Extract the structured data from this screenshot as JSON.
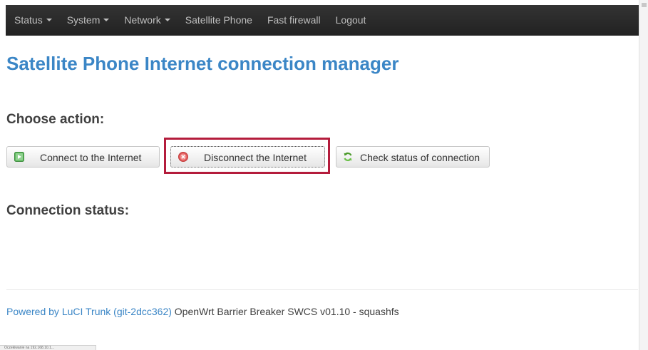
{
  "nav": {
    "items": [
      {
        "label": "Status",
        "dropdown": true
      },
      {
        "label": "System",
        "dropdown": true
      },
      {
        "label": "Network",
        "dropdown": true
      },
      {
        "label": "Satellite Phone",
        "dropdown": false
      },
      {
        "label": "Fast firewall",
        "dropdown": false
      },
      {
        "label": "Logout",
        "dropdown": false
      }
    ]
  },
  "page": {
    "title": "Satellite Phone Internet connection manager",
    "choose_action_heading": "Choose action:",
    "connection_status_heading": "Connection status:"
  },
  "actions": {
    "connect": {
      "label": "Connect to the Internet",
      "icon": "play-icon"
    },
    "disconnect": {
      "label": "Disconnect the Internet",
      "icon": "stop-circle-icon"
    },
    "check": {
      "label": "Check status of connection",
      "icon": "refresh-icon"
    }
  },
  "footer": {
    "link_text": "Powered by LuCI Trunk (git-2dcc362)",
    "text": " OpenWrt Barrier Breaker SWCS v01.10 - squashfs"
  },
  "statusbar": {
    "text": "Oczekiwanie na 192.168.10.1..."
  },
  "colors": {
    "navbar_bg": "#2b2b2b",
    "title": "#3b86c6",
    "link": "#3b86c6",
    "highlight_border": "#b41c3c"
  }
}
